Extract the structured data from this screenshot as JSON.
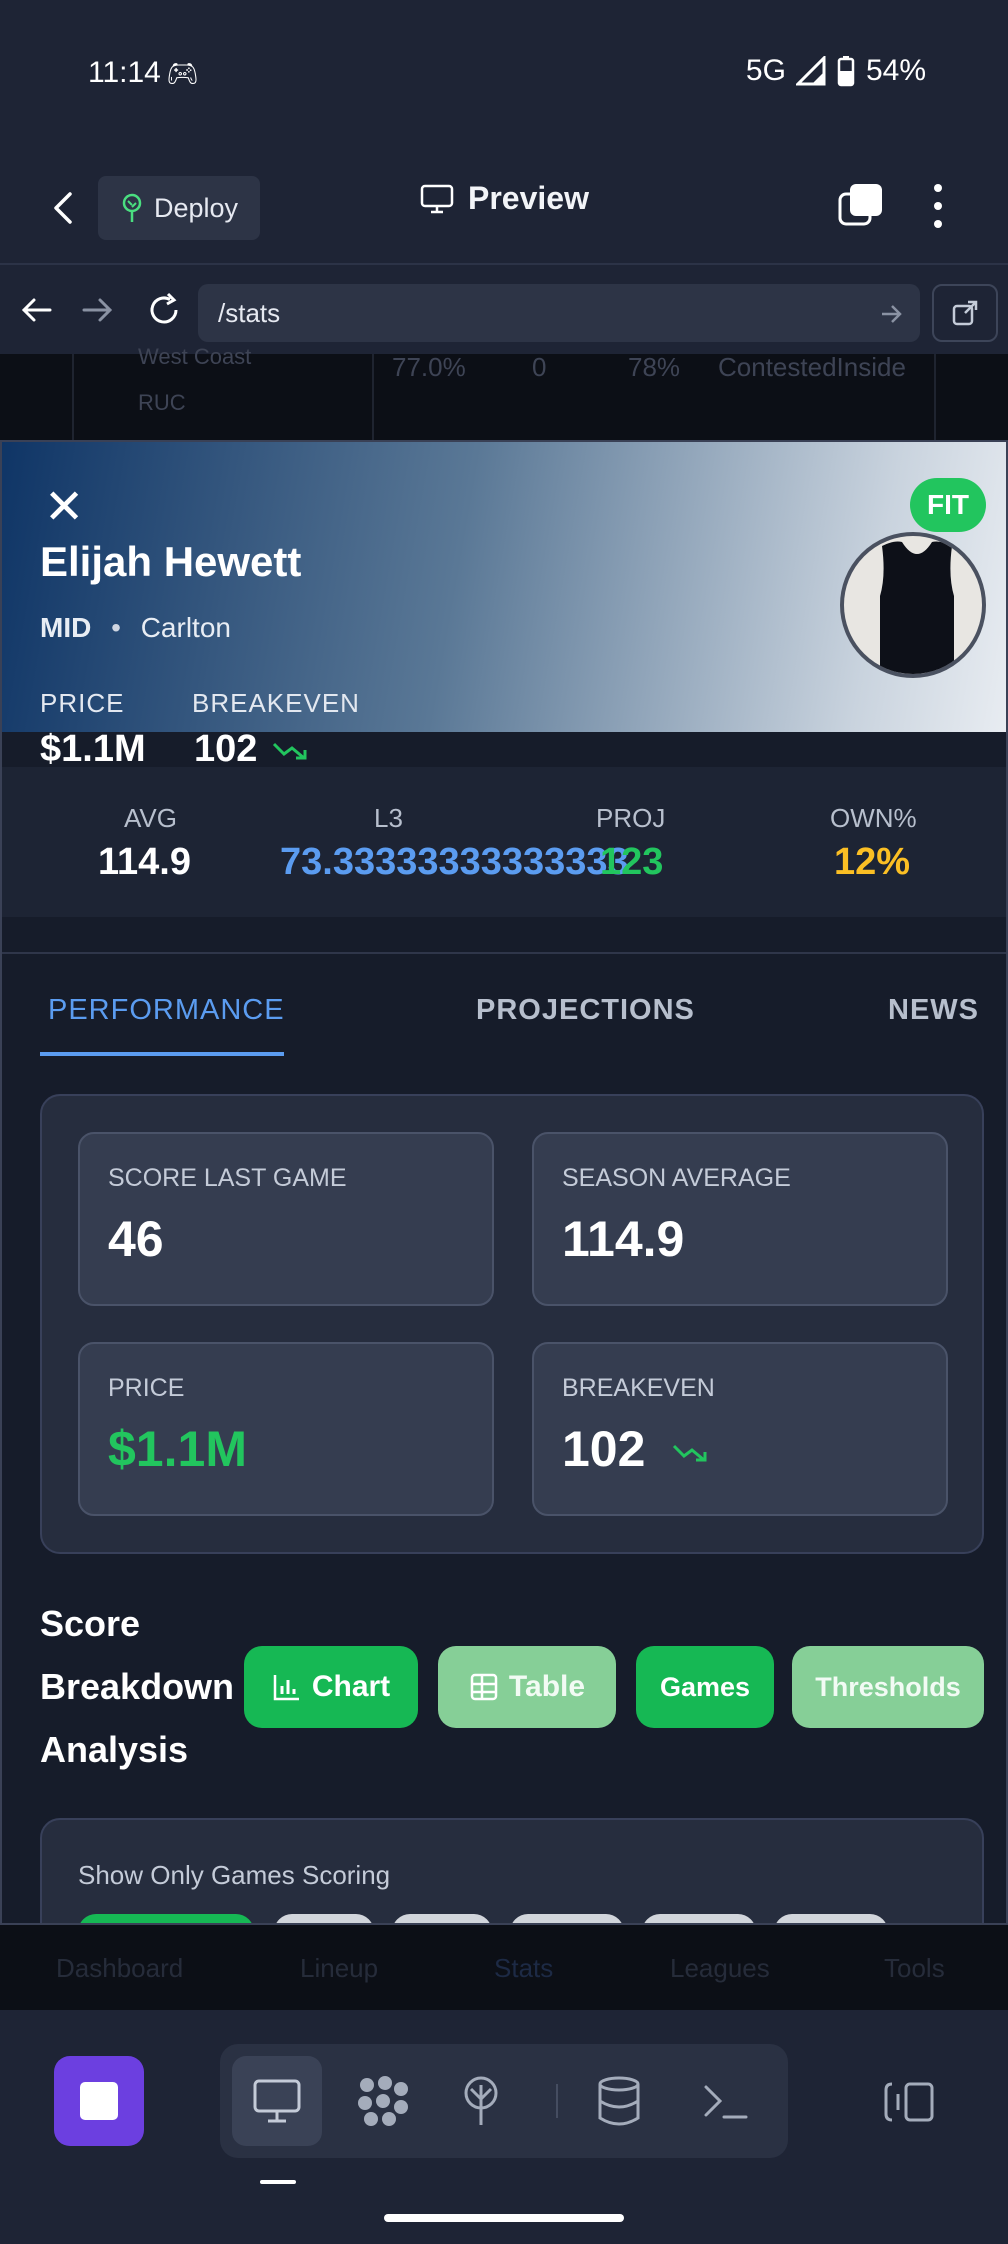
{
  "status_bar": {
    "time": "11:14",
    "network": "5G",
    "battery": "54%"
  },
  "app_bar": {
    "deploy_label": "Deploy",
    "preview_label": "Preview"
  },
  "url_bar": {
    "path": "/stats"
  },
  "peek_row": {
    "team": "West Coast",
    "position": "RUC",
    "col1": "77.0%",
    "col2": "0",
    "col3": "78%",
    "col4": "ContestedInside"
  },
  "player": {
    "fit_badge": "FIT",
    "name": "Elijah Hewett",
    "position": "MID",
    "team": "Carlton",
    "price_label": "PRICE",
    "price": "$1.1M",
    "breakeven_label": "BREAKEVEN",
    "breakeven": "102"
  },
  "stats": [
    {
      "label": "AVG",
      "value": "114.9",
      "color": "#ffffff"
    },
    {
      "label": "L3",
      "value": "73.33333333333333",
      "color": "#5b9cf0"
    },
    {
      "label": "PROJ",
      "value": "123",
      "color": "#22c55e"
    },
    {
      "label": "OWN%",
      "value": "12%",
      "color": "#fbbf24"
    }
  ],
  "tabs": [
    "PERFORMANCE",
    "PROJECTIONS",
    "NEWS"
  ],
  "cards": [
    {
      "label": "SCORE LAST GAME",
      "value": "46"
    },
    {
      "label": "SEASON AVERAGE",
      "value": "114.9"
    },
    {
      "label": "PRICE",
      "value": "$1.1M"
    },
    {
      "label": "BREAKEVEN",
      "value": "102"
    }
  ],
  "breakdown": {
    "title_line1": "Score",
    "title_line2": "Breakdown",
    "title_line3": "Analysis",
    "buttons": [
      "Chart",
      "Table",
      "Games",
      "Thresholds"
    ]
  },
  "filter": {
    "label": "Show Only Games Scoring"
  },
  "bottom_nav": [
    "Dashboard",
    "Lineup",
    "Stats",
    "Leagues",
    "Tools"
  ],
  "colors": {
    "accent_blue": "#5b9cf0",
    "green": "#22c55e",
    "yellow": "#fbbf24",
    "stop_purple": "#6c3fe0"
  }
}
